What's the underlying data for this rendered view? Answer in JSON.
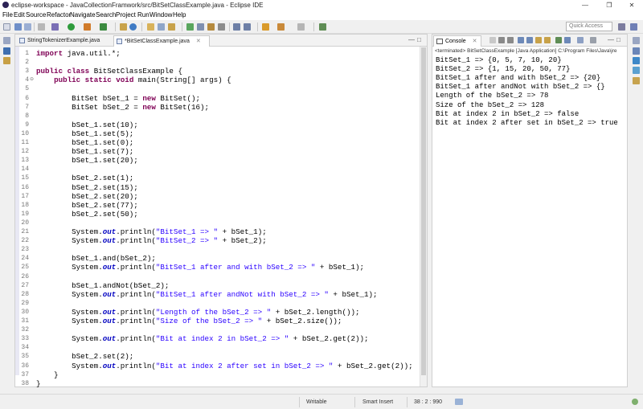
{
  "window": {
    "title": "eclipse-workspace - JavaCollectionFramwork/src/BitSetClassExample.java - Eclipse IDE"
  },
  "menu": [
    "File",
    "Edit",
    "Source",
    "Refactor",
    "Navigate",
    "Search",
    "Project",
    "Run",
    "Window",
    "Help"
  ],
  "quick_access": {
    "placeholder": "Quick Access"
  },
  "editor": {
    "tabs": [
      {
        "label": "StringTokenizerExample.java",
        "active": false
      },
      {
        "label": "*BitSetClassExample.java",
        "active": true
      }
    ],
    "line_numbers": [
      "1",
      "2",
      "3",
      "4",
      "5",
      "6",
      "7",
      "8",
      "9",
      "10",
      "11",
      "12",
      "13",
      "14",
      "15",
      "16",
      "17",
      "18",
      "19",
      "20",
      "21",
      "22",
      "23",
      "24",
      "25",
      "26",
      "27",
      "28",
      "29",
      "30",
      "31",
      "32",
      "33",
      "34",
      "35",
      "36",
      "37",
      "38"
    ],
    "lines": [
      [
        {
          "t": "import",
          "c": "kw"
        },
        {
          "t": " java.util.*;",
          "c": "var"
        }
      ],
      [],
      [
        {
          "t": "public",
          "c": "kw"
        },
        {
          "t": " ",
          "c": "var"
        },
        {
          "t": "class",
          "c": "kw"
        },
        {
          "t": " BitSetClassExample {",
          "c": "var"
        }
      ],
      [
        {
          "t": "    ",
          "c": "var"
        },
        {
          "t": "public",
          "c": "kw"
        },
        {
          "t": " ",
          "c": "var"
        },
        {
          "t": "static",
          "c": "kw"
        },
        {
          "t": " ",
          "c": "var"
        },
        {
          "t": "void",
          "c": "kw"
        },
        {
          "t": " main(String[] args) {",
          "c": "var"
        }
      ],
      [],
      [
        {
          "t": "        BitSet bSet_1 = ",
          "c": "var"
        },
        {
          "t": "new",
          "c": "kw"
        },
        {
          "t": " BitSet();",
          "c": "var"
        }
      ],
      [
        {
          "t": "        BitSet bSet_2 = ",
          "c": "var"
        },
        {
          "t": "new",
          "c": "kw"
        },
        {
          "t": " BitSet(16);",
          "c": "var"
        }
      ],
      [],
      [
        {
          "t": "        bSet_1.set(10);",
          "c": "var"
        }
      ],
      [
        {
          "t": "        bSet_1.set(5);",
          "c": "var"
        }
      ],
      [
        {
          "t": "        bSet_1.set(0);",
          "c": "var"
        }
      ],
      [
        {
          "t": "        bSet_1.set(7);",
          "c": "var"
        }
      ],
      [
        {
          "t": "        bSet_1.set(20);",
          "c": "var"
        }
      ],
      [],
      [
        {
          "t": "        bSet_2.set(1);",
          "c": "var"
        }
      ],
      [
        {
          "t": "        bSet_2.set(15);",
          "c": "var"
        }
      ],
      [
        {
          "t": "        bSet_2.set(20);",
          "c": "var"
        }
      ],
      [
        {
          "t": "        bSet_2.set(77);",
          "c": "var"
        }
      ],
      [
        {
          "t": "        bSet_2.set(50);",
          "c": "var"
        }
      ],
      [],
      [
        {
          "t": "        System.",
          "c": "var"
        },
        {
          "t": "out",
          "c": "fld"
        },
        {
          "t": ".println(",
          "c": "var"
        },
        {
          "t": "\"BitSet_1 => \"",
          "c": "str"
        },
        {
          "t": " + bSet_1);",
          "c": "var"
        }
      ],
      [
        {
          "t": "        System.",
          "c": "var"
        },
        {
          "t": "out",
          "c": "fld"
        },
        {
          "t": ".println(",
          "c": "var"
        },
        {
          "t": "\"BitSet_2 => \"",
          "c": "str"
        },
        {
          "t": " + bSet_2);",
          "c": "var"
        }
      ],
      [],
      [
        {
          "t": "        bSet_1.and(bSet_2);",
          "c": "var"
        }
      ],
      [
        {
          "t": "        System.",
          "c": "var"
        },
        {
          "t": "out",
          "c": "fld"
        },
        {
          "t": ".println(",
          "c": "var"
        },
        {
          "t": "\"BitSet_1 after and with bSet_2 => \"",
          "c": "str"
        },
        {
          "t": " + bSet_1);",
          "c": "var"
        }
      ],
      [],
      [
        {
          "t": "        bSet_1.andNot(bSet_2);",
          "c": "var"
        }
      ],
      [
        {
          "t": "        System.",
          "c": "var"
        },
        {
          "t": "out",
          "c": "fld"
        },
        {
          "t": ".println(",
          "c": "var"
        },
        {
          "t": "\"BitSet_1 after andNot with bSet_2 => \"",
          "c": "str"
        },
        {
          "t": " + bSet_1);",
          "c": "var"
        }
      ],
      [],
      [
        {
          "t": "        System.",
          "c": "var"
        },
        {
          "t": "out",
          "c": "fld"
        },
        {
          "t": ".println(",
          "c": "var"
        },
        {
          "t": "\"Length of the bSet_2 => \"",
          "c": "str"
        },
        {
          "t": " + bSet_2.length());",
          "c": "var"
        }
      ],
      [
        {
          "t": "        System.",
          "c": "var"
        },
        {
          "t": "out",
          "c": "fld"
        },
        {
          "t": ".println(",
          "c": "var"
        },
        {
          "t": "\"Size of the bSet_2 => \"",
          "c": "str"
        },
        {
          "t": " + bSet_2.size());",
          "c": "var"
        }
      ],
      [],
      [
        {
          "t": "        System.",
          "c": "var"
        },
        {
          "t": "out",
          "c": "fld"
        },
        {
          "t": ".println(",
          "c": "var"
        },
        {
          "t": "\"Bit at index 2 in bSet_2 => \"",
          "c": "str"
        },
        {
          "t": " + bSet_2.get(2));",
          "c": "var"
        }
      ],
      [],
      [
        {
          "t": "        bSet_2.set(2);",
          "c": "var"
        }
      ],
      [
        {
          "t": "        System.",
          "c": "var"
        },
        {
          "t": "out",
          "c": "fld"
        },
        {
          "t": ".println(",
          "c": "var"
        },
        {
          "t": "\"Bit at index 2 after set in bSet_2 => \"",
          "c": "str"
        },
        {
          "t": " + bSet_2.get(2));",
          "c": "var"
        }
      ],
      [
        {
          "t": "    }",
          "c": "var"
        }
      ],
      [
        {
          "t": "}",
          "c": "var"
        }
      ]
    ]
  },
  "console": {
    "tab_label": "Console",
    "status": "<terminated> BitSetClassExample [Java Application] C:\\Program Files\\Java\\jre",
    "output": [
      "BitSet_1 => {0, 5, 7, 10, 20}",
      "BitSet_2 => {1, 15, 20, 50, 77}",
      "BitSet_1 after and with bSet_2 => {20}",
      "BitSet_1 after andNot with bSet_2 => {}",
      "Length of the bSet_2 => 78",
      "Size of the bSet_2 => 128",
      "Bit at index 2 in bSet_2 => false",
      "Bit at index 2 after set in bSet_2 => true"
    ]
  },
  "statusbar": {
    "mode": "Writable",
    "insert": "Smart Insert",
    "position": "38 : 2 : 990"
  },
  "colors": {
    "keyword": "#7f0055",
    "string": "#2a00ff",
    "field": "#0000c0"
  }
}
